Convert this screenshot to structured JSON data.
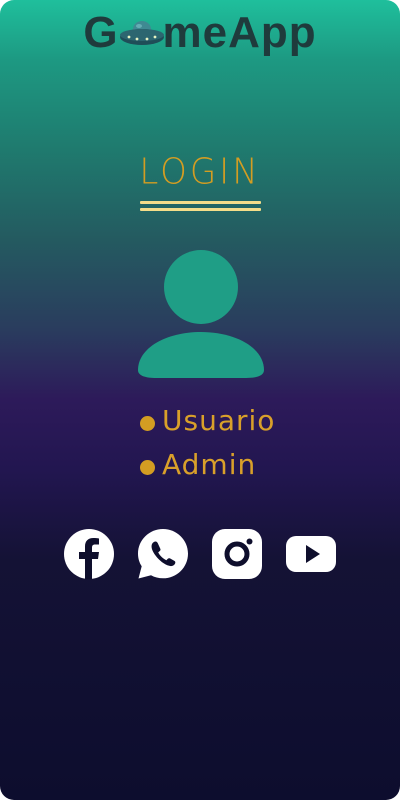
{
  "app": {
    "brand_prefix": "G",
    "brand_suffix": "meApp"
  },
  "login": {
    "title": "LOGIN"
  },
  "roles": [
    {
      "label": "Usuario"
    },
    {
      "label": "Admin"
    }
  ],
  "social": [
    {
      "icon": "facebook-icon"
    },
    {
      "icon": "whatsapp-icon"
    },
    {
      "icon": "instagram-icon"
    },
    {
      "icon": "youtube-icon"
    }
  ],
  "colors": {
    "accent": "#d39d22",
    "avatar": "#1f9e86",
    "underline": "#f4dd8a",
    "brand_text": "#1f3b3c",
    "gradient_top": "#1fbf9c",
    "gradient_bottom": "#0d0d2e"
  }
}
